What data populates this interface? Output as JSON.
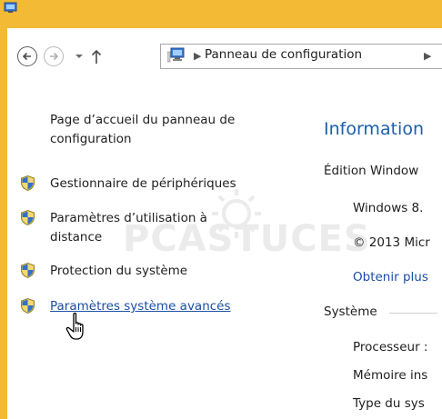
{
  "colors": {
    "title_bar": "#f2ba35",
    "link": "#1a4ea3",
    "heading": "#1c5ea8"
  },
  "nav": {
    "back_icon": "back-arrow-icon",
    "forward_icon": "forward-arrow-icon",
    "dropdown_icon": "chevron-down-icon",
    "up_icon": "up-arrow-icon",
    "breadcrumb": {
      "location_icon": "computer-icon",
      "items": [
        "Panneau de configuration"
      ]
    }
  },
  "left_pane": {
    "home_link": "Page d’accueil du panneau de configuration",
    "tasks": [
      {
        "label": "Gestionnaire de périphériques",
        "icon": "uac-shield-icon"
      },
      {
        "label": "Paramètres d’utilisation à distance",
        "icon": "uac-shield-icon"
      },
      {
        "label": "Protection du système",
        "icon": "uac-shield-icon"
      },
      {
        "label": "Paramètres système avancés",
        "icon": "uac-shield-icon"
      }
    ]
  },
  "watermark": {
    "text": "PCASTUCES"
  },
  "main": {
    "heading": "Information",
    "edition_section": "Édition Window",
    "edition_lines": [
      "Windows 8.",
      "© 2013 Micr",
      "Obtenir plus"
    ],
    "system_section": "Système",
    "system_lines": [
      "Processeur :",
      "Mémoire ins",
      "Type du sys"
    ]
  }
}
